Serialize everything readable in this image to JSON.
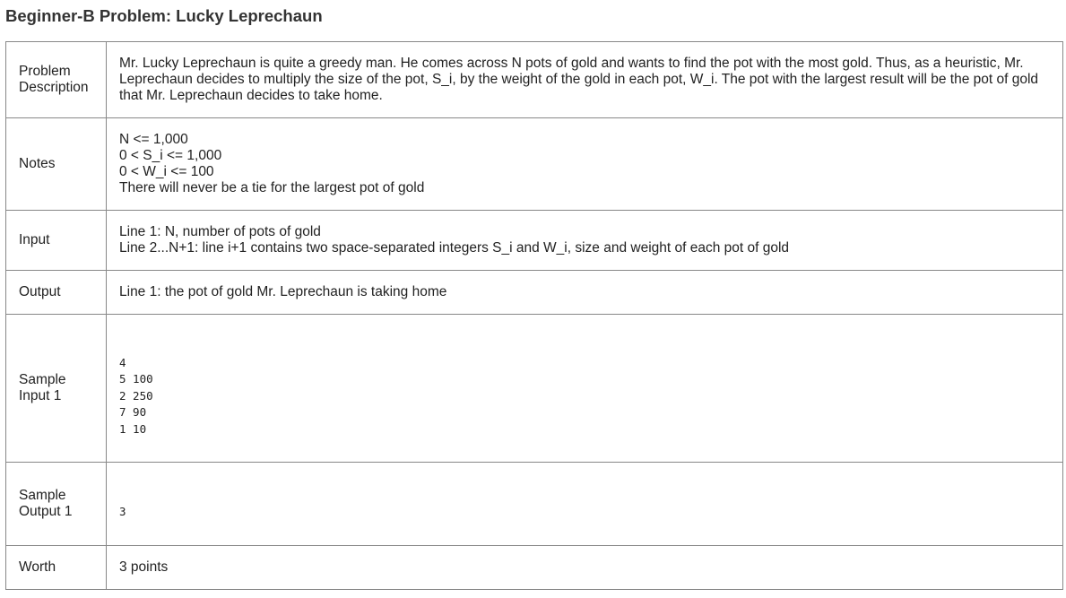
{
  "title": "Beginner-B Problem: Lucky Leprechaun",
  "rows": {
    "description": {
      "label": "Problem Description",
      "text": "Mr. Lucky Leprechaun is quite a greedy man. He comes across N pots of gold and wants to find the pot with the most gold. Thus, as a heuristic, Mr. Leprechaun decides to multiply the size of the pot, S_i, by the weight of the gold in each pot, W_i. The pot with the largest result will be the pot of gold that Mr. Leprechaun decides to take home."
    },
    "notes": {
      "label": "Notes",
      "lines": [
        "N <= 1,000",
        "0 < S_i <= 1,000",
        "0 < W_i <= 100",
        "There will never be a tie for the largest pot of gold"
      ]
    },
    "input": {
      "label": "Input",
      "lines": [
        "Line 1: N, number of pots of gold",
        "Line 2...N+1: line i+1 contains two space-separated integers S_i and W_i, size and weight of each pot of gold"
      ]
    },
    "output": {
      "label": "Output",
      "text": "Line 1: the pot of gold Mr. Leprechaun is taking home"
    },
    "sample_input": {
      "label": "Sample Input 1",
      "text": "4\n5 100\n2 250\n7 90\n1 10"
    },
    "sample_output": {
      "label": "Sample Output 1",
      "text": "3"
    },
    "worth": {
      "label": "Worth",
      "text": "3 points"
    }
  }
}
